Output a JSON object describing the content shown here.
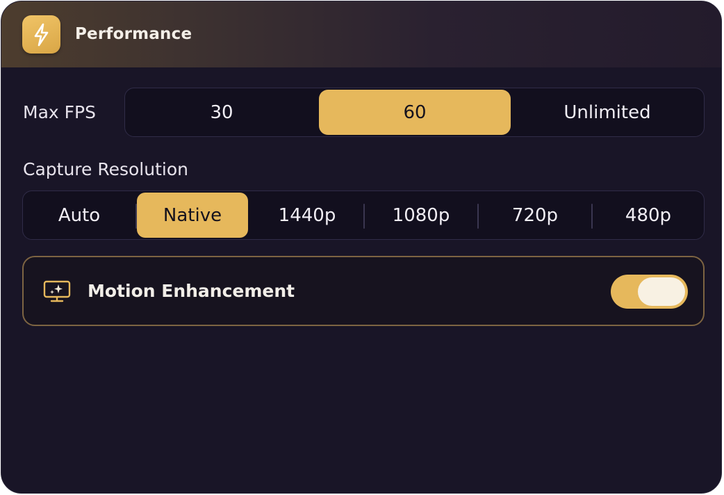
{
  "header": {
    "icon": "lightning-bolt-icon",
    "title": "Performance"
  },
  "max_fps": {
    "label": "Max FPS",
    "options": [
      "30",
      "60",
      "Unlimited"
    ],
    "selected": "60"
  },
  "capture_resolution": {
    "label": "Capture Resolution",
    "options": [
      "Auto",
      "Native",
      "1440p",
      "1080p",
      "720p",
      "480p"
    ],
    "selected": "Native"
  },
  "motion_enhancement": {
    "icon": "monitor-sparkle-icon",
    "label": "Motion Enhancement",
    "enabled": true
  },
  "colors": {
    "accent": "#e6b85c",
    "background": "#191527",
    "segment_background": "#120f1e",
    "highlight_border": "#7d6442",
    "text": "#f1eef5"
  }
}
